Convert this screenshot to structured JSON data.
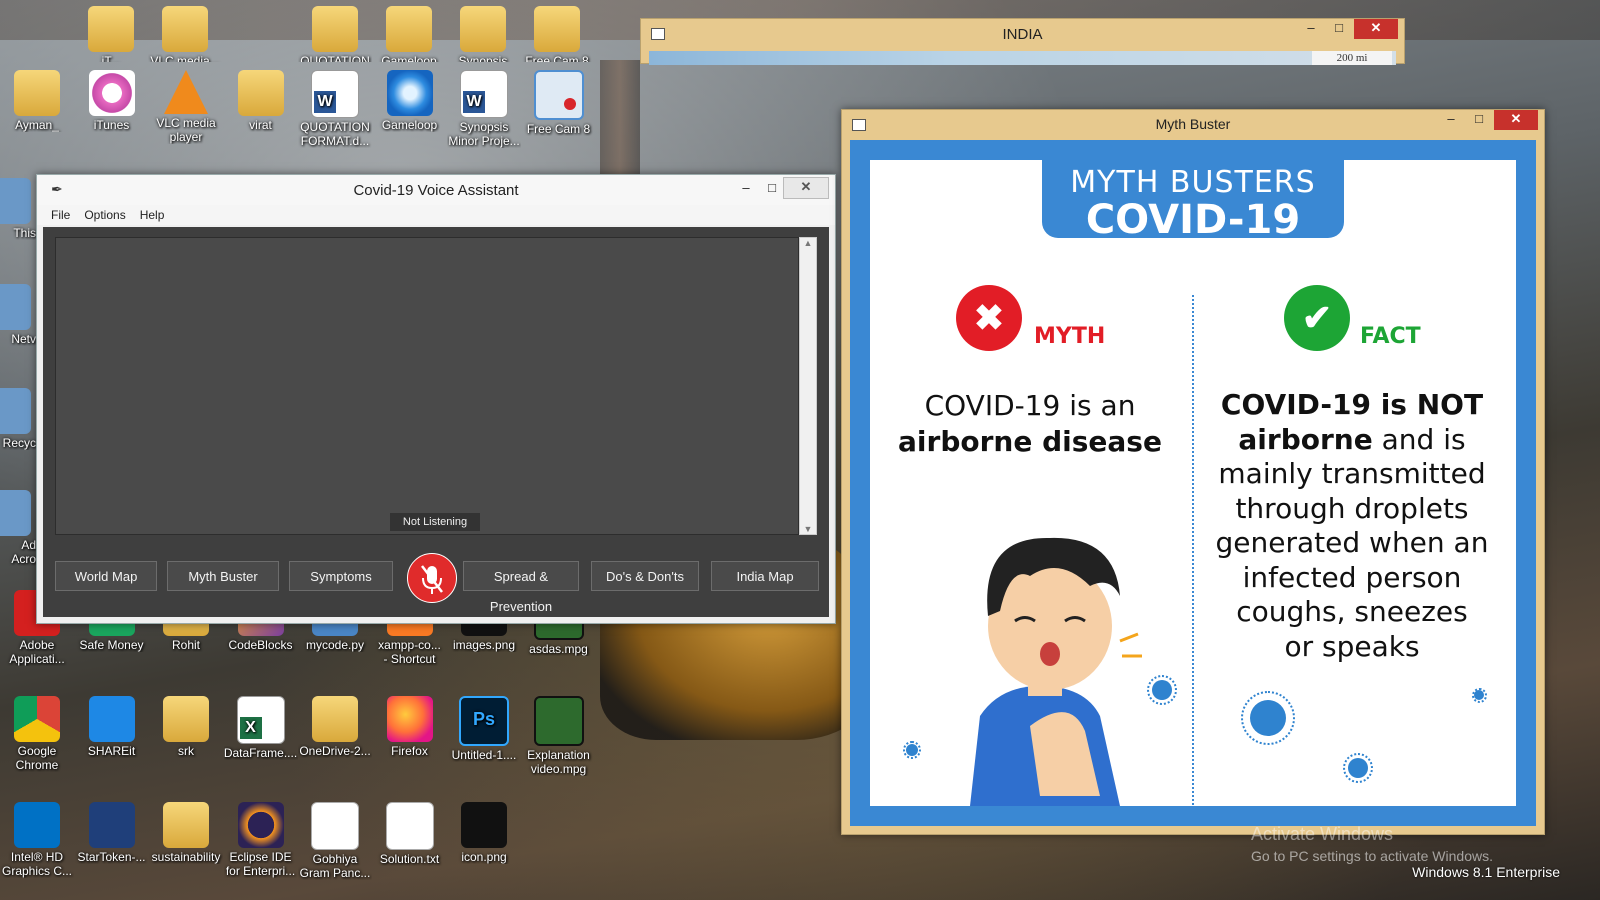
{
  "desktop": {
    "top_row_partial": [
      "iT...",
      "VLC media...",
      "QUOTATION",
      "Gameloop",
      "Synopsis",
      "Free Cam 8"
    ],
    "row1": [
      {
        "label": "Ayman_",
        "icon": "user-folder-icon"
      },
      {
        "label": "iTunes",
        "icon": "itunes-icon"
      },
      {
        "label": "VLC media\nplayer",
        "icon": "vlc-icon"
      },
      {
        "label": "virat",
        "icon": "folder-icon"
      },
      {
        "label": "QUOTATION\nFORMAT.d...",
        "icon": "word-doc-icon"
      },
      {
        "label": "Gameloop",
        "icon": "gameloop-icon"
      },
      {
        "label": "Synopsis\nMinor Proje...",
        "icon": "word-doc-icon"
      },
      {
        "label": "Free Cam 8",
        "icon": "free-cam-icon"
      }
    ],
    "left_partial": [
      "This",
      "Netv",
      "Recyc",
      "Ad\nAcro"
    ],
    "row_mid": [
      {
        "label": "Adobe\nApplicati...",
        "icon": "adobe-icon"
      },
      {
        "label": "Safe Money",
        "icon": "safe-money-icon"
      },
      {
        "label": "Rohit",
        "icon": "folder-icon"
      },
      {
        "label": "CodeBlocks",
        "icon": "codeblocks-icon"
      },
      {
        "label": "mycode.py",
        "icon": "python-file-icon"
      },
      {
        "label": "xampp-co...\n- Shortcut",
        "icon": "xampp-icon"
      },
      {
        "label": "images.png",
        "icon": "image-file-icon"
      },
      {
        "label": "asdas.mpg",
        "icon": "video-file-icon"
      }
    ],
    "row_low": [
      {
        "label": "Google\nChrome",
        "icon": "chrome-icon"
      },
      {
        "label": "SHAREit",
        "icon": "shareit-icon"
      },
      {
        "label": "srk",
        "icon": "folder-icon"
      },
      {
        "label": "DataFrame....",
        "icon": "excel-file-icon"
      },
      {
        "label": "OneDrive-2...",
        "icon": "zip-folder-icon"
      },
      {
        "label": "Firefox",
        "icon": "firefox-icon"
      },
      {
        "label": "Untitled-1....",
        "icon": "photoshop-file-icon"
      },
      {
        "label": "Explanation\nvideo.mpg",
        "icon": "video-file-icon"
      }
    ],
    "row_bottom": [
      {
        "label": "Intel® HD\nGraphics C...",
        "icon": "intel-icon"
      },
      {
        "label": "StarToken-...",
        "icon": "startoken-icon"
      },
      {
        "label": "sustainability",
        "icon": "folder-icon"
      },
      {
        "label": "Eclipse IDE\nfor Enterpri...",
        "icon": "eclipse-icon"
      },
      {
        "label": "Gobhiya\nGram Panc...",
        "icon": "document-icon"
      },
      {
        "label": "Solution.txt",
        "icon": "text-file-icon"
      },
      {
        "label": "icon.png",
        "icon": "image-file-icon"
      }
    ],
    "watermark": "Activate Windows",
    "watermark_sub": "Go to PC settings to activate Windows.",
    "edition": "Windows 8.1 Enterprise"
  },
  "india_window": {
    "title": "INDIA",
    "scale": "200 mi"
  },
  "assistant": {
    "title": "Covid-19 Voice Assistant",
    "menu": [
      "File",
      "Options",
      "Help"
    ],
    "status": "Not Listening",
    "buttons": [
      "World Map",
      "Myth Buster",
      "Symptoms",
      "Spread & Prevention",
      "Do's & Don'ts",
      "India Map"
    ],
    "mic_icon": "microphone-muted-icon"
  },
  "myth_window": {
    "title": "Myth Buster",
    "poster": {
      "header_line1": "MYTH BUSTERS",
      "header_line2": "COVID-19",
      "myth_label": "MYTH",
      "fact_label": "FACT",
      "myth_text_plain": "COVID-19 is an",
      "myth_text_bold": "airborne disease",
      "fact_text_bold1": "COVID-19 is NOT",
      "fact_text_bold2": "airborne",
      "fact_text_rest1": " and is",
      "fact_text_rest2": "mainly transmitted",
      "fact_text_rest3": "through droplets",
      "fact_text_rest4": "generated when an",
      "fact_text_rest5": "infected person",
      "fact_text_rest6": "coughs, sneezes",
      "fact_text_rest7": "or speaks"
    },
    "colors": {
      "frame_blue": "#3a88d3",
      "myth_red": "#e21d26",
      "fact_green": "#1da535"
    }
  }
}
